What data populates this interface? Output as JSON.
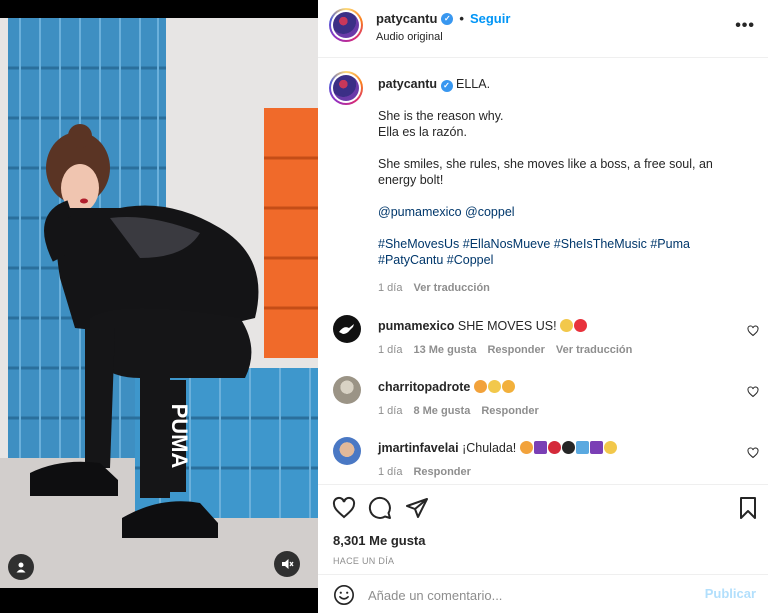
{
  "post": {
    "username": "patycantu",
    "follow_label": "Seguir",
    "audio_label": "Audio original",
    "more_label": "•••"
  },
  "caption": {
    "username": "patycantu",
    "title": "ELLA.",
    "line1": "She is the reason why.",
    "line2": "Ella es la razón.",
    "line3": "She smiles, she rules, she moves like a boss, a free soul, an energy bolt!",
    "mentions": "@pumamexico @coppel",
    "hashtags": "#SheMovesUs #EllaNosMueve #SheIsTheMusic #Puma #PatyCantu #Coppel",
    "time": "1 día",
    "translate": "Ver traducción"
  },
  "comments": [
    {
      "username": "pumamexico",
      "text": "SHE MOVES US!",
      "time": "1 día",
      "likes": "13 Me gusta",
      "reply": "Responder",
      "translate": "Ver traducción",
      "emojis": [
        "#f2c84b",
        "#e8323c"
      ]
    },
    {
      "username": "charritopadrote",
      "text": "",
      "time": "1 día",
      "likes": "8 Me gusta",
      "reply": "Responder",
      "emojis": [
        "#f2a23b",
        "#f2c84b",
        "#f2b03b"
      ]
    },
    {
      "username": "jmartinfavelai",
      "text": "¡Chulada!",
      "time": "1 día",
      "reply": "Responder",
      "emojis": [
        "#f2a23b",
        "#7a3fb5",
        "#d42a3a",
        "#262626",
        "#5aa9e0",
        "#7a3fb5",
        "#f2c84b"
      ]
    }
  ],
  "actions": {
    "likes": "8,301 Me gusta",
    "ago": "HACE UN DÍA"
  },
  "composer": {
    "placeholder": "Añade un comentario...",
    "publish": "Publicar"
  },
  "colors": {
    "link": "#00376b",
    "follow": "#0095f6",
    "publish_disabled": "#b2dffc",
    "muted": "#8e8e8e"
  },
  "icons": [
    "verified-badge-icon",
    "more-icon",
    "heart-icon",
    "comment-icon",
    "share-icon",
    "bookmark-icon",
    "emoji-icon",
    "user-tag-icon",
    "mute-icon"
  ]
}
